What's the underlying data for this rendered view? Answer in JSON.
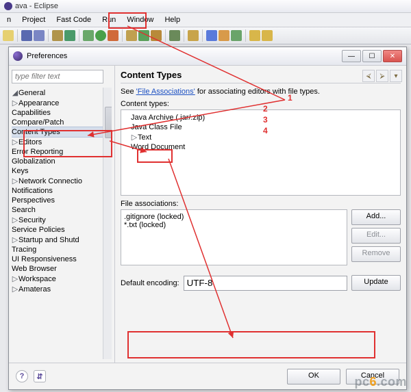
{
  "app": {
    "title": "ava - Eclipse"
  },
  "menubar": [
    "n",
    "Project",
    "Fast Code",
    "Run",
    "Window",
    "Help"
  ],
  "dialog": {
    "title": "Preferences",
    "filter_placeholder": "type filter text",
    "tree": {
      "root": "General",
      "items": [
        "Appearance",
        "Capabilities",
        "Compare/Patch",
        "Content Types",
        "Editors",
        "Error Reporting",
        "Globalization",
        "Keys",
        "Network Connectio",
        "Notifications",
        "Perspectives",
        "Search",
        "Security",
        "Service Policies",
        "Startup and Shutd",
        "Tracing",
        "UI Responsiveness",
        "Web Browser",
        "Workspace"
      ],
      "next_root": "Amateras"
    },
    "heading": "Content Types",
    "see_prefix": "See ",
    "see_link": "'File Associations'",
    "see_suffix": " for associating editors with file types.",
    "ct_label": "Content types:",
    "ct_items": [
      "Java Archive (.jar/.zip)",
      "Java Class File",
      "Text",
      "Word Document"
    ],
    "fa_label": "File associations:",
    "fa_items": [
      ".gitignore (locked)",
      "*.txt (locked)"
    ],
    "buttons": {
      "add": "Add...",
      "edit": "Edit...",
      "remove": "Remove",
      "update": "Update"
    },
    "enc_label": "Default encoding:",
    "enc_value": "UTF-8",
    "ok": "OK",
    "cancel": "Cancel"
  },
  "annotations": {
    "n1": "1",
    "n2": "2",
    "n3": "3",
    "n4": "4"
  },
  "watermark": {
    "left": "pc",
    "right": ".com",
    "mid": "6"
  }
}
